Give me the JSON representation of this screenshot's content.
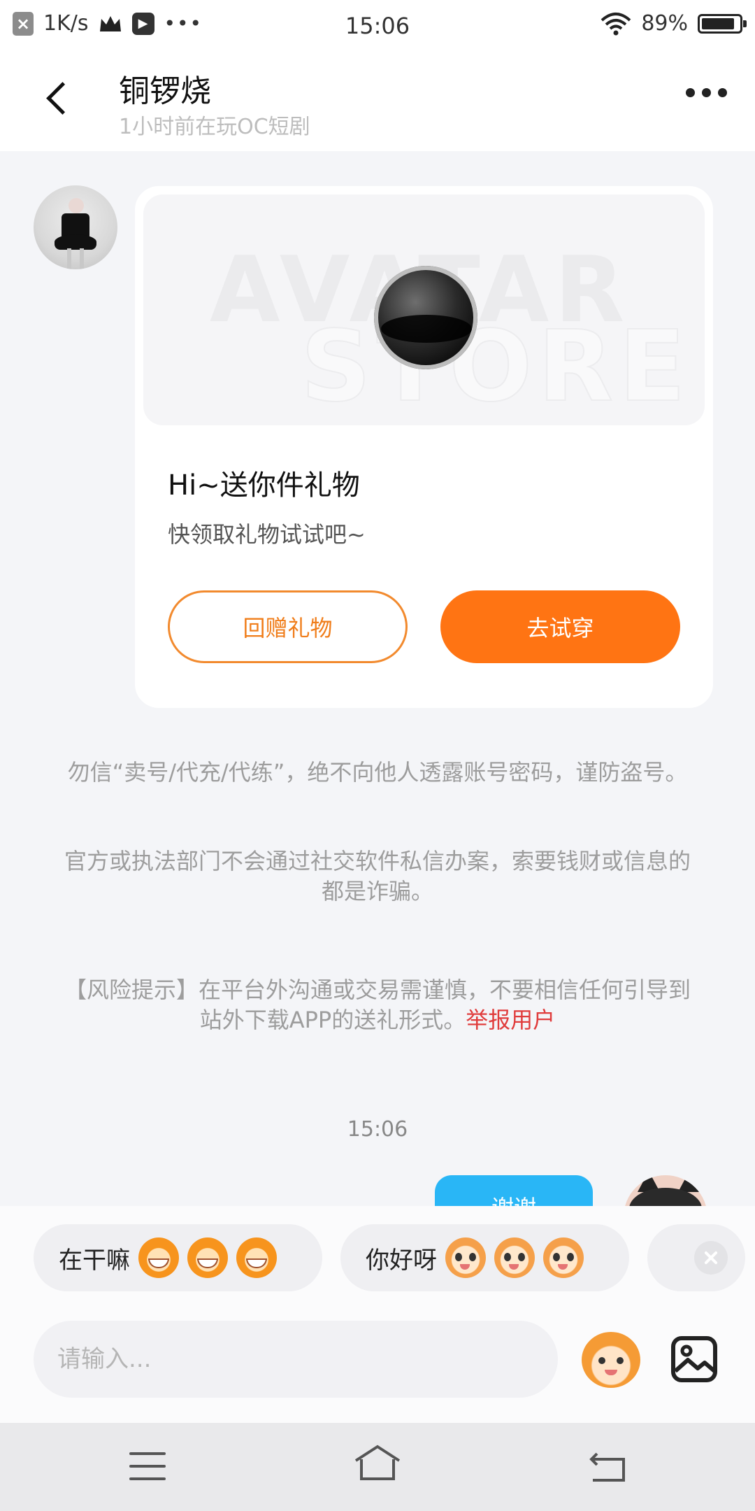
{
  "status_bar": {
    "speed": "1K/s",
    "time": "15:06",
    "battery": "89%",
    "battery_level": 0.89
  },
  "header": {
    "title": "铜锣烧",
    "subtitle": "1小时前在玩OC短剧"
  },
  "gift_card": {
    "banner_watermark_line1": "AVATAR",
    "banner_watermark_line2": "STORE",
    "title": "Hi~送你件礼物",
    "subtitle": "快领取礼物试试吧~",
    "return_gift_label": "回赠礼物",
    "try_on_label": "去试穿"
  },
  "notices": {
    "warning1": "勿信“卖号/代充/代练”，绝不向他人透露账号密码，谨防盗号。",
    "warning2": "官方或执法部门不会通过社交软件私信办案，索要钱财或信息的都是诈骗。",
    "risk_tip": "【风险提示】在平台外沟通或交易需谨慎，不要相信任何引导到站外下载APP的送礼形式。",
    "report_link": "举报用户"
  },
  "chat": {
    "time": "15:06",
    "my_message": "谢谢"
  },
  "quick_replies": [
    {
      "text": "在干嘛"
    },
    {
      "text": "你好呀"
    }
  ],
  "input": {
    "placeholder": "请输入..."
  },
  "colors": {
    "accent_orange": "#ff7413",
    "bubble_blue": "#29b6f6",
    "report_red": "#e03c3c"
  }
}
